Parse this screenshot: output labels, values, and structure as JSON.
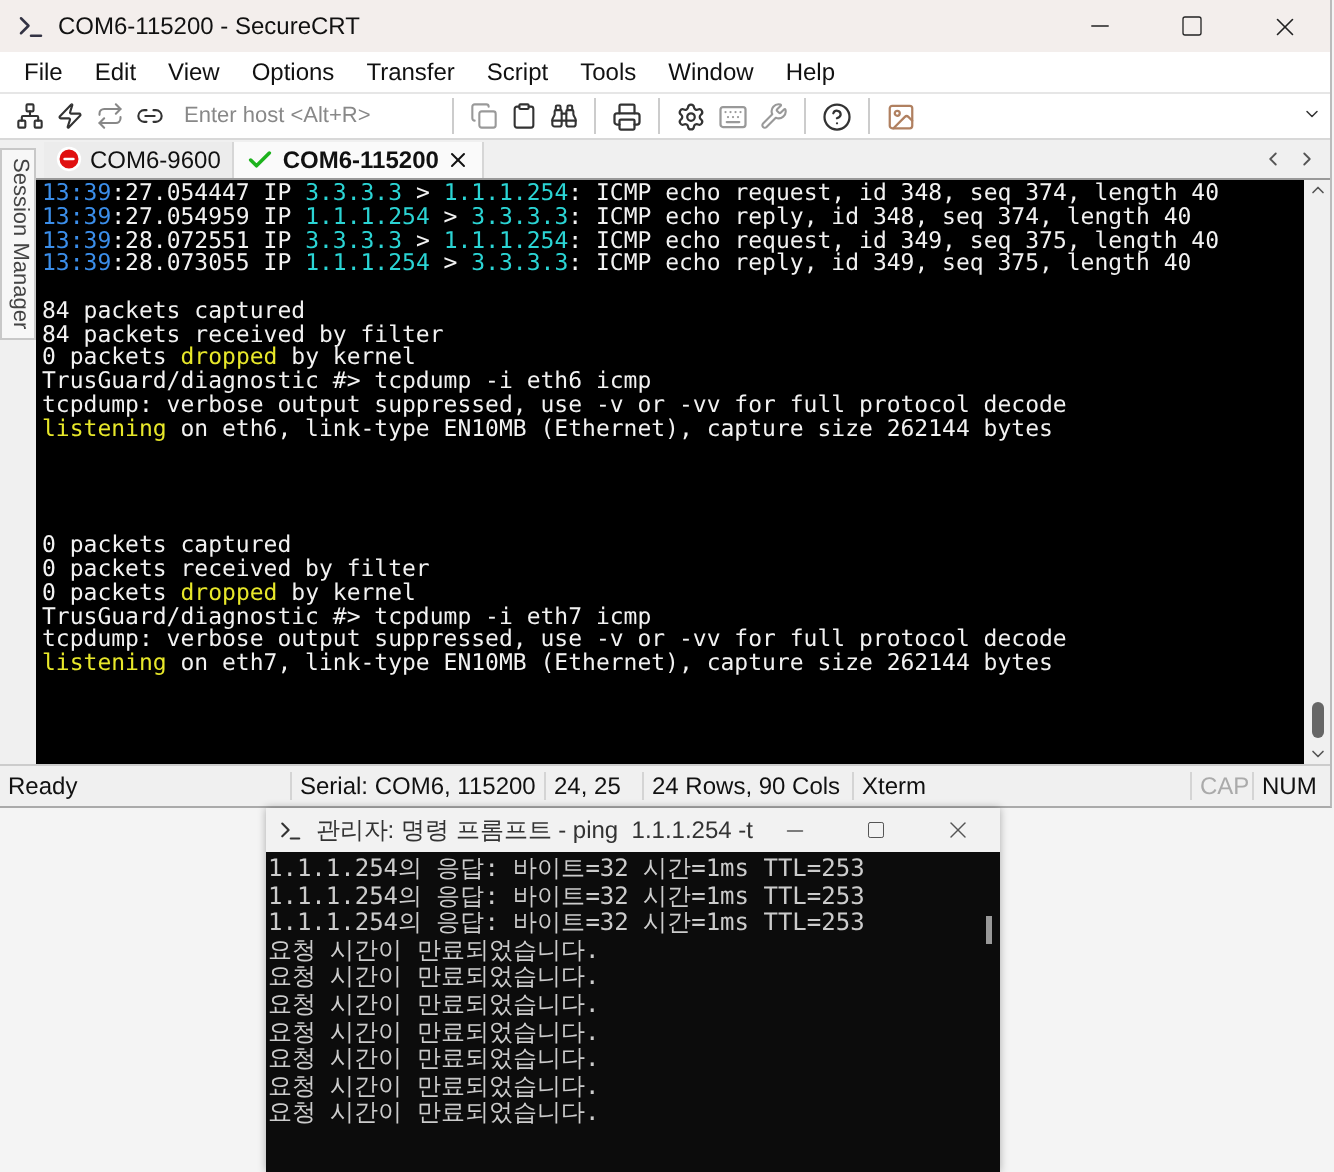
{
  "window": {
    "title": "COM6-115200 - SecureCRT"
  },
  "menu": [
    "File",
    "Edit",
    "View",
    "Options",
    "Transfer",
    "Script",
    "Tools",
    "Window",
    "Help"
  ],
  "toolbar": {
    "host_placeholder": "Enter host <Alt+R>"
  },
  "side_panel": {
    "label": "Session Manager"
  },
  "tabs": [
    {
      "label": "COM6-9600",
      "selected": false,
      "kind": "disconnected"
    },
    {
      "label": "COM6-115200",
      "selected": true,
      "kind": "connected"
    }
  ],
  "terminal": {
    "lines": [
      {
        "kind": "text",
        "segments": [
          {
            "kind": "time",
            "text": "13:39"
          },
          {
            "kind": "plain",
            "text": ":27.054447 IP "
          },
          {
            "kind": "ip",
            "text": "3.3.3.3"
          },
          {
            "kind": "plain",
            "text": " > "
          },
          {
            "kind": "ip",
            "text": "1.1.1.254"
          },
          {
            "kind": "plain",
            "text": ": ICMP echo request, id 348, seq 374, length 40"
          }
        ]
      },
      {
        "kind": "text",
        "segments": [
          {
            "kind": "time",
            "text": "13:39"
          },
          {
            "kind": "plain",
            "text": ":27.054959 IP "
          },
          {
            "kind": "ip",
            "text": "1.1.1.254"
          },
          {
            "kind": "plain",
            "text": " > "
          },
          {
            "kind": "ip",
            "text": "3.3.3.3"
          },
          {
            "kind": "plain",
            "text": ": ICMP echo reply, id 348, seq 374, length 40"
          }
        ]
      },
      {
        "kind": "text",
        "segments": [
          {
            "kind": "time",
            "text": "13:39"
          },
          {
            "kind": "plain",
            "text": ":28.072551 IP "
          },
          {
            "kind": "ip",
            "text": "3.3.3.3"
          },
          {
            "kind": "plain",
            "text": " > "
          },
          {
            "kind": "ip",
            "text": "1.1.1.254"
          },
          {
            "kind": "plain",
            "text": ": ICMP echo request, id 349, seq 375, length 40"
          }
        ]
      },
      {
        "kind": "text",
        "segments": [
          {
            "kind": "time",
            "text": "13:39"
          },
          {
            "kind": "plain",
            "text": ":28.073055 IP "
          },
          {
            "kind": "ip",
            "text": "1.1.1.254"
          },
          {
            "kind": "plain",
            "text": " > "
          },
          {
            "kind": "ip",
            "text": "3.3.3.3"
          },
          {
            "kind": "plain",
            "text": ": ICMP echo reply, id 349, seq 375, length 40"
          }
        ]
      },
      {
        "kind": "blank"
      },
      {
        "kind": "text",
        "segments": [
          {
            "kind": "plain",
            "text": "84 packets captured"
          }
        ]
      },
      {
        "kind": "text",
        "segments": [
          {
            "kind": "plain",
            "text": "84 packets received by filter"
          }
        ]
      },
      {
        "kind": "text",
        "segments": [
          {
            "kind": "plain",
            "text": "0 packets "
          },
          {
            "kind": "warn",
            "text": "dropped"
          },
          {
            "kind": "plain",
            "text": " by kernel"
          }
        ]
      },
      {
        "kind": "text",
        "segments": [
          {
            "kind": "plain",
            "text": "TrusGuard/diagnostic #> tcpdump -i eth6 icmp"
          }
        ]
      },
      {
        "kind": "text",
        "segments": [
          {
            "kind": "plain",
            "text": "tcpdump: verbose output suppressed, use -v or -vv for full protocol decode"
          }
        ]
      },
      {
        "kind": "text",
        "segments": [
          {
            "kind": "warn",
            "text": "listening"
          },
          {
            "kind": "plain",
            "text": " on eth6, link-type EN10MB (Ethernet), capture size 262144 bytes"
          }
        ]
      },
      {
        "kind": "blank"
      },
      {
        "kind": "blank"
      },
      {
        "kind": "blank"
      },
      {
        "kind": "blank"
      },
      {
        "kind": "text",
        "segments": [
          {
            "kind": "plain",
            "text": "0 packets captured"
          }
        ]
      },
      {
        "kind": "text",
        "segments": [
          {
            "kind": "plain",
            "text": "0 packets received by filter"
          }
        ]
      },
      {
        "kind": "text",
        "segments": [
          {
            "kind": "plain",
            "text": "0 packets "
          },
          {
            "kind": "warn",
            "text": "dropped"
          },
          {
            "kind": "plain",
            "text": " by kernel"
          }
        ]
      },
      {
        "kind": "text",
        "segments": [
          {
            "kind": "plain",
            "text": "TrusGuard/diagnostic #> tcpdump -i eth7 icmp"
          }
        ]
      },
      {
        "kind": "text",
        "segments": [
          {
            "kind": "plain",
            "text": "tcpdump: verbose output suppressed, use -v or -vv for full protocol decode"
          }
        ]
      },
      {
        "kind": "text",
        "segments": [
          {
            "kind": "warn",
            "text": "listening"
          },
          {
            "kind": "plain",
            "text": " on eth7, link-type EN10MB (Ethernet), capture size 262144 bytes"
          }
        ]
      }
    ]
  },
  "status_bar": [
    {
      "text": "Ready",
      "disabled": false
    },
    {
      "text": "Serial: COM6, 115200",
      "disabled": false
    },
    {
      "text": "24,  25",
      "disabled": false
    },
    {
      "text": "24 Rows, 90 Cols",
      "disabled": false
    },
    {
      "text": "Xterm",
      "disabled": false
    },
    {
      "text": "CAP",
      "disabled": true
    },
    {
      "text": "NUM",
      "disabled": false
    }
  ],
  "cmd_window": {
    "title": "관리자: 명령 프롬프트 - ping  1.1.1.254 -t",
    "lines": [
      "1.1.1.254의 응답: 바이트=32 시간=1ms TTL=253",
      "1.1.1.254의 응답: 바이트=32 시간=1ms TTL=253",
      "1.1.1.254의 응답: 바이트=32 시간=1ms TTL=253",
      "요청 시간이 만료되었습니다.",
      "요청 시간이 만료되었습니다.",
      "요청 시간이 만료되었습니다.",
      "요청 시간이 만료되었습니다.",
      "요청 시간이 만료되었습니다.",
      "요청 시간이 만료되었습니다.",
      "요청 시간이 만료되었습니다."
    ]
  }
}
